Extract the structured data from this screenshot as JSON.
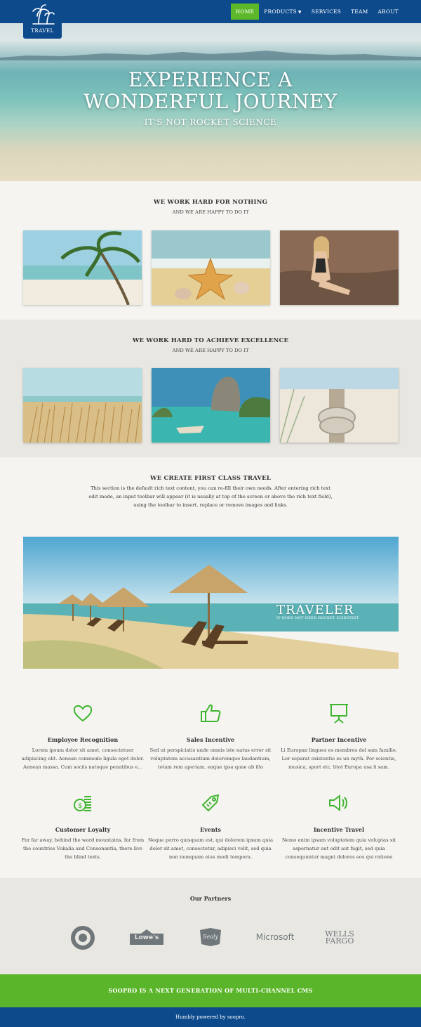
{
  "header": {
    "logo_text": "TRAVEL",
    "menu": [
      {
        "label": "HOME",
        "active": true
      },
      {
        "label": "PRODUCTS",
        "has_dropdown": true
      },
      {
        "label": "SERVICES"
      },
      {
        "label": "TEAM"
      },
      {
        "label": "ABOUT"
      }
    ]
  },
  "hero": {
    "title_line1": "EXPERIENCE A",
    "title_line2": "WONDERFUL JOURNEY",
    "subtitle": "IT'S NOT ROCKET SCIENCE"
  },
  "section1": {
    "title": "WE WORK HARD FOR NOTHING",
    "subtitle": "AND WE ARE HAPPY TO DO IT"
  },
  "section2": {
    "title": "WE WORK HARD TO ACHIEVE EXCELLENCE",
    "subtitle": "AND WE ARE HAPPY TO DO IT"
  },
  "section3": {
    "title": "WE CREATE FIRST CLASS TRAVEL",
    "body": "This section is the default rich text content, you can re-fill their own needs. After entering rich text edit mode, an input toolbar will appear (it is usually at top of the screen or above the rich text field), using the toolbar to insert, replace or remove images and links."
  },
  "banner": {
    "title": "TRAVELER",
    "subtitle": "IT DOES NOT NEED ROCKET SCIENTIST"
  },
  "features": [
    {
      "icon": "heart-icon",
      "title": "Employee Recognition",
      "text": "Lorem ipsum dolor sit amet, consectetuer adipiscing elit. Aenean commodo ligula eget dolor. Aenean massa. Cum sociis natoque penatibus e..."
    },
    {
      "icon": "thumbs-up-icon",
      "title": "Sales Incentive",
      "text": "Sed ut perspiciatis unde omnis iste natus error sit voluptatem accusantium doloremque laudantium, totam rem aperiam, eaque ipsa quae ab illo"
    },
    {
      "icon": "presentation-board-icon",
      "title": "Partner Incentive",
      "text": "Li Europan lingues es membres del sam familie. Lor separat existentie es un myth. Por scientie, musica, sport etc, litot Europa usa li sam."
    },
    {
      "icon": "coins-icon",
      "title": "Customer Loyalty",
      "text": "Far far away, behind the word mountains, far from the countries Vokalia and Consonantia, there live the blind texts."
    },
    {
      "icon": "price-tag-icon",
      "title": "Events",
      "text": "Neque porro quisquam est, qui dolorem ipsum quia dolor sit amet, consectetur, adipisci velit, sed quia non numquam eius modi tempora."
    },
    {
      "icon": "megaphone-icon",
      "title": "Incentive Travel",
      "text": "Nemo enim ipsam voluptatem quia voluptas sit aspernatur aut odit aut fugit, sed quia consequuntur magni dolores eos qui ratione"
    }
  ],
  "partners": {
    "title": "Our Partners",
    "logos": [
      "Lowe's",
      "Sealy",
      "Microsoft",
      "WELLS",
      "FARGO"
    ]
  },
  "cta": {
    "text": "SOOPRO IS A NEXT GENERATION OF MULTI-CHANNEL CMS"
  },
  "footer": {
    "text": "Humbly powered by soopro."
  },
  "colors": {
    "nav_blue": "#0d4a8c",
    "accent_green": "#5bb52a",
    "icon_green": "#3fb530"
  }
}
